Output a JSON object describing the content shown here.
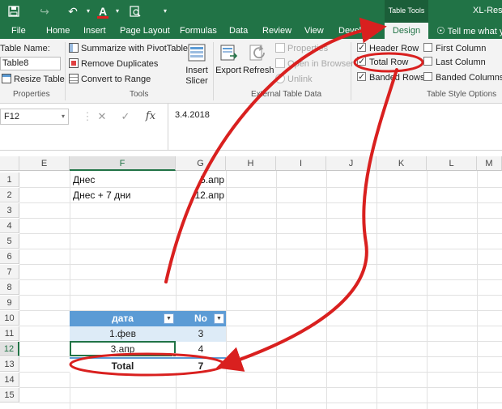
{
  "titlebar": {
    "table_tools_label": "Table Tools",
    "app_title": "XL-Resiz",
    "qat": [
      "save-icon",
      "undo-icon",
      "redo-icon",
      "font-color-icon",
      "print-preview-icon",
      "customize-qat-icon"
    ]
  },
  "tabs": [
    "File",
    "Home",
    "Insert",
    "Page Layout",
    "Formulas",
    "Data",
    "Review",
    "View",
    "Developer",
    "Design",
    "Tell me what yo"
  ],
  "ribbon": {
    "properties": {
      "table_name_label": "Table Name:",
      "table_name_value": "Table8",
      "resize_label": "Resize Table",
      "group_label": "Properties"
    },
    "tools": {
      "summarize": "Summarize with PivotTable",
      "remove_duplicates": "Remove Duplicates",
      "convert_to_range": "Convert to Range",
      "insert_slicer_line1": "Insert",
      "insert_slicer_line2": "Slicer",
      "group_label": "Tools"
    },
    "external": {
      "export": "Export",
      "refresh": "Refresh",
      "properties": "Properties",
      "open_in_browser": "Open in Browser",
      "unlink": "Unlink",
      "group_label": "External Table Data"
    },
    "style_options": {
      "header_row": "Header Row",
      "total_row": "Total Row",
      "banded_rows": "Banded Rows",
      "first_column": "First Column",
      "last_column": "Last Column",
      "banded_columns": "Banded Columns",
      "group_label": "Table Style Options"
    }
  },
  "formula_bar": {
    "name_box": "F12",
    "cancel": "✕",
    "enter": "✓",
    "fx": "fx",
    "value": "3.4.2018"
  },
  "columns": [
    "E",
    "F",
    "G",
    "H",
    "I",
    "J",
    "K",
    "L",
    "M"
  ],
  "rows": [
    "1",
    "2",
    "3",
    "4",
    "5",
    "6",
    "7",
    "8",
    "9",
    "10",
    "11",
    "12",
    "13",
    "14",
    "15"
  ],
  "cells": {
    "F1": "Днес",
    "G1": "5.апр",
    "F2": "Днес + 7 дни",
    "G2": "12.апр"
  },
  "table": {
    "header": [
      "дата",
      "No"
    ],
    "rows": [
      [
        "1.фев",
        "3"
      ],
      [
        "3.апр",
        "4"
      ]
    ],
    "total": [
      "Total",
      "7"
    ]
  },
  "colors": {
    "excel_green": "#217346",
    "table_header": "#5b9bd5",
    "band": "#ddebf7",
    "annotation_red": "#d9201f"
  }
}
